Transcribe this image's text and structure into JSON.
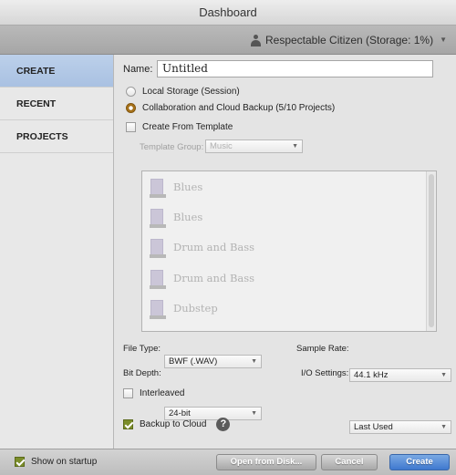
{
  "window": {
    "title": "Dashboard"
  },
  "account": {
    "label": "Respectable Citizen (Storage: 1%)"
  },
  "sidebar": {
    "items": [
      {
        "label": "CREATE"
      },
      {
        "label": "RECENT"
      },
      {
        "label": "PROJECTS"
      }
    ]
  },
  "form": {
    "name_label": "Name:",
    "name_value": "Untitled",
    "local_storage_label": "Local Storage (Session)",
    "cloud_label": "Collaboration and Cloud Backup (5/10 Projects)",
    "create_from_template_label": "Create From Template",
    "template_group_label": "Template Group:",
    "template_group_value": "Music",
    "templates": [
      "Blues",
      "Blues",
      "Drum and Bass",
      "Drum and Bass",
      "Dubstep"
    ],
    "file_type_label": "File Type:",
    "file_type_value": "BWF (.WAV)",
    "sample_rate_label": "Sample Rate:",
    "sample_rate_value": "44.1 kHz",
    "bit_depth_label": "Bit Depth:",
    "bit_depth_value": "24-bit",
    "io_settings_label": "I/O Settings:",
    "io_settings_value": "Last Used",
    "interleaved_label": "Interleaved",
    "backup_label": "Backup to Cloud",
    "help_glyph": "?"
  },
  "footer": {
    "show_on_startup_label": "Show on startup",
    "open_from_disk_label": "Open from Disk...",
    "cancel_label": "Cancel",
    "create_label": "Create"
  },
  "colors": {
    "selection_blue": "#a9c1e2",
    "radio_orange": "#c88a24",
    "checkbox_green": "#7b8d2a",
    "primary_button": "#3f78cf"
  },
  "icons": [
    "person-icon",
    "chevron-down-icon",
    "document-icon",
    "help-icon",
    "checkmark-icon"
  ]
}
